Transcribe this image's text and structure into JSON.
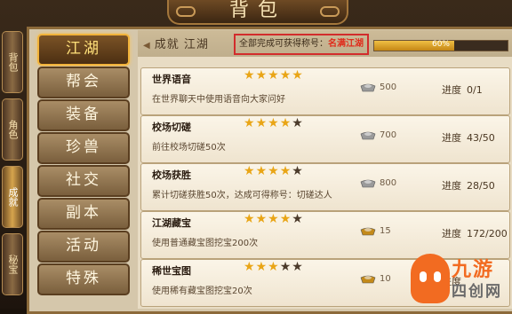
{
  "window": {
    "title": "背包"
  },
  "side_scrolls": [
    {
      "label": "背包",
      "active": false
    },
    {
      "label": "角色",
      "active": false
    },
    {
      "label": "成就",
      "active": true
    },
    {
      "label": "秘宝",
      "active": false
    }
  ],
  "tabs": [
    {
      "label": "江湖",
      "active": true
    },
    {
      "label": "帮会",
      "active": false
    },
    {
      "label": "装备",
      "active": false
    },
    {
      "label": "珍兽",
      "active": false
    },
    {
      "label": "社交",
      "active": false
    },
    {
      "label": "副本",
      "active": false
    },
    {
      "label": "活动",
      "active": false
    },
    {
      "label": "特殊",
      "active": false
    }
  ],
  "header": {
    "breadcrumb": "成就 江湖",
    "reward_label": "全部完成可获得称号：",
    "reward_title": "名满江湖",
    "progress_text": "60%",
    "progress_fraction": 0.6
  },
  "achievements": [
    {
      "name": "世界语音",
      "desc": "在世界聊天中使用语音向大家问好",
      "stars": 5,
      "max_stars": 5,
      "reward": "500",
      "progress_label": "进度",
      "progress": "0/1",
      "ingot_type": "silver"
    },
    {
      "name": "校场切磋",
      "desc": "前往校场切磋50次",
      "stars": 4,
      "max_stars": 5,
      "reward": "700",
      "progress_label": "进度",
      "progress": "43/50",
      "ingot_type": "silver"
    },
    {
      "name": "校场获胜",
      "desc": "累计切磋获胜50次，达成可得称号：切磋达人",
      "stars": 4,
      "max_stars": 5,
      "reward": "800",
      "progress_label": "进度",
      "progress": "28/50",
      "ingot_type": "silver"
    },
    {
      "name": "江湖藏宝",
      "desc": "使用普通藏宝图挖宝200次",
      "stars": 4,
      "max_stars": 5,
      "reward": "15",
      "progress_label": "进度",
      "progress": "172/200",
      "ingot_type": "gold"
    },
    {
      "name": "稀世宝图",
      "desc": "使用稀有藏宝图挖宝20次",
      "stars": 3,
      "max_stars": 5,
      "reward": "10",
      "progress_label": "进度",
      "progress": "",
      "ingot_type": "gold"
    }
  ],
  "watermark": {
    "line1": "九游",
    "line2": "四创网"
  },
  "colors": {
    "gold": "#e9a516",
    "silver_ingot": "#9a9a9a",
    "gold_ingot": "#c48a1a",
    "highlight_red": "#d22c2c"
  }
}
